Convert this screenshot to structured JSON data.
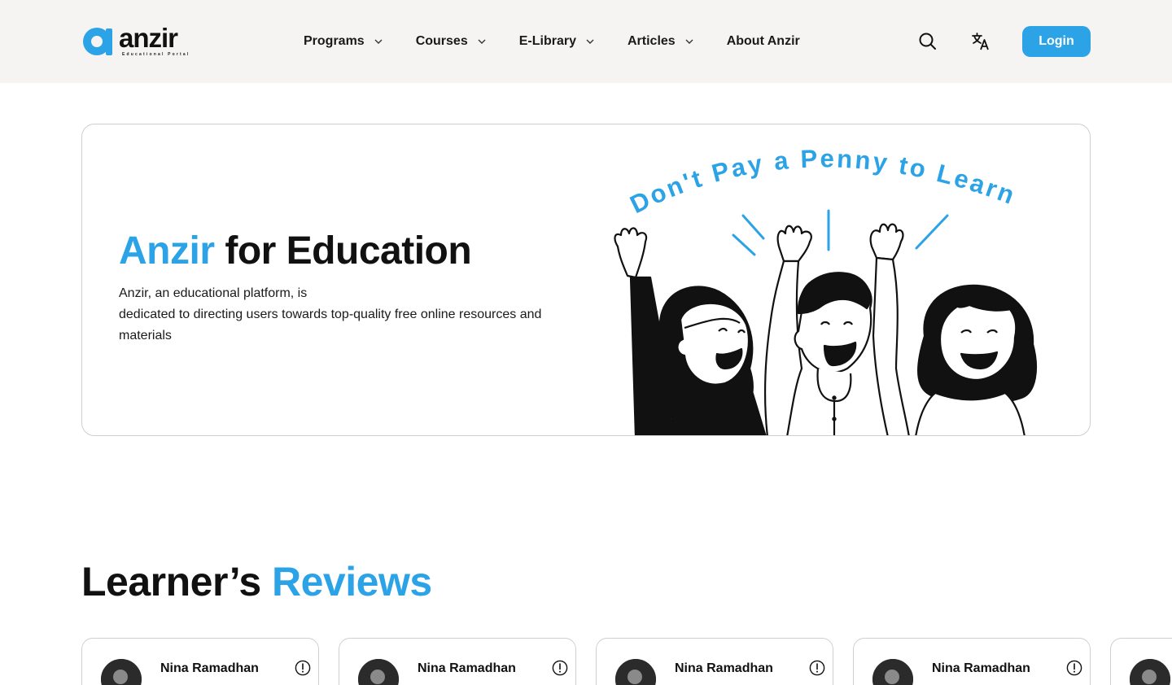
{
  "header": {
    "logo_word": "anzir",
    "logo_tagline": "Educational Portal",
    "nav": [
      {
        "label": "Programs",
        "has_dropdown": true
      },
      {
        "label": "Courses",
        "has_dropdown": true
      },
      {
        "label": "E-Library",
        "has_dropdown": true
      },
      {
        "label": "Articles",
        "has_dropdown": true
      },
      {
        "label": "About Anzir",
        "has_dropdown": false
      }
    ],
    "search_icon": "search-icon",
    "language_icon": "translate-icon",
    "login_label": "Login"
  },
  "hero": {
    "title_accent": "Anzir",
    "title_rest": " for Education",
    "description_line1": "Anzir, an educational platform, is",
    "description_line2": "dedicated to directing users towards top-quality free online resources and materials",
    "illustration_text": "Don't Pay a Penny to Learn"
  },
  "reviews": {
    "title_plain": "Learner’s ",
    "title_accent": "Reviews",
    "cards": [
      {
        "name": "Nina Ramadhan"
      },
      {
        "name": "Nina Ramadhan"
      },
      {
        "name": "Nina Ramadhan"
      },
      {
        "name": "Nina Ramadhan"
      },
      {
        "name": ""
      }
    ]
  },
  "colors": {
    "accent": "#2ba3e6",
    "header_bg": "#f5f4f2",
    "text": "#111111"
  }
}
